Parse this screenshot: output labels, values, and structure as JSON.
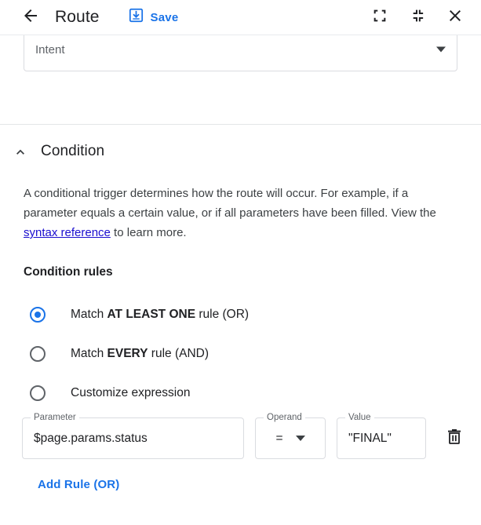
{
  "header": {
    "back_icon": "arrow-back-icon",
    "title": "Route",
    "save_icon": "save-icon",
    "save_label": "Save",
    "expand_icon": "fullscreen-expand-icon",
    "collapse_icon": "fullscreen-collapse-icon",
    "close_icon": "close-icon"
  },
  "intent": {
    "label": "Intent",
    "value": "",
    "dropdown_icon": "chevron-down-icon"
  },
  "condition": {
    "collapse_icon": "chevron-up-icon",
    "title": "Condition",
    "description_before_link": "A conditional trigger determines how the route will occur. For example, if a parameter equals a certain value, or if all parameters have been filled. View the ",
    "link_text": "syntax reference",
    "description_after_link": " to learn more.",
    "rules_title": "Condition rules",
    "radio_options": [
      {
        "text_prefix": "Match ",
        "text_bold": "AT LEAST ONE",
        "text_suffix": " rule (OR)",
        "selected": true
      },
      {
        "text_prefix": "Match ",
        "text_bold": "EVERY",
        "text_suffix": " rule (AND)",
        "selected": false
      },
      {
        "text_prefix": "Customize expression",
        "text_bold": "",
        "text_suffix": "",
        "selected": false
      }
    ],
    "rule": {
      "parameter_label": "Parameter",
      "parameter_value": "$page.params.status",
      "operand_label": "Operand",
      "operand_value": "=",
      "operand_dropdown_icon": "chevron-down-icon",
      "value_label": "Value",
      "value_value": "\"FINAL\"",
      "delete_icon": "trash-icon"
    },
    "add_rule_label": "Add Rule (OR)"
  },
  "colors": {
    "accent": "#1a73e8",
    "link": "#1a0dcf",
    "text": "#202124",
    "muted": "#5f6368",
    "border": "#dadce0"
  }
}
